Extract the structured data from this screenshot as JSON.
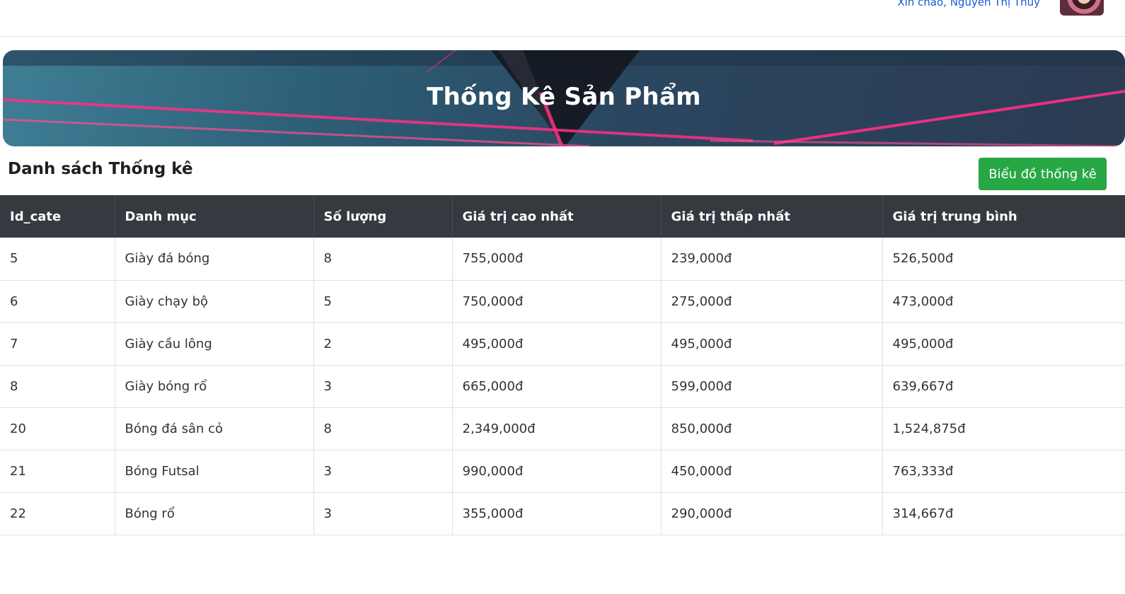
{
  "header": {
    "user_link": "Xin chào, Nguyễn Thị Thùy"
  },
  "banner": {
    "title": "Thống Kê Sản Phẩm"
  },
  "section": {
    "title": "Danh sách Thống kê",
    "chart_button": "Biểu đồ thống kê"
  },
  "colors": {
    "header_bg": "#343a40",
    "button_bg": "#28a745",
    "banner_accent": "#ff2f86"
  },
  "table": {
    "columns": [
      "Id_cate",
      "Danh mục",
      "Số lượng",
      "Giá trị cao nhất",
      "Giá trị thấp nhất",
      "Giá trị trung bình"
    ],
    "rows": [
      [
        "5",
        "Giày đá bóng",
        "8",
        "755,000đ",
        "239,000đ",
        "526,500đ"
      ],
      [
        "6",
        "Giày chạy bộ",
        "5",
        "750,000đ",
        "275,000đ",
        "473,000đ"
      ],
      [
        "7",
        "Giày cầu lông",
        "2",
        "495,000đ",
        "495,000đ",
        "495,000đ"
      ],
      [
        "8",
        "Giày bóng rổ",
        "3",
        "665,000đ",
        "599,000đ",
        "639,667đ"
      ],
      [
        "20",
        "Bóng đá sân cỏ",
        "8",
        "2,349,000đ",
        "850,000đ",
        "1,524,875đ"
      ],
      [
        "21",
        "Bóng Futsal",
        "3",
        "990,000đ",
        "450,000đ",
        "763,333đ"
      ],
      [
        "22",
        "Bóng rổ",
        "3",
        "355,000đ",
        "290,000đ",
        "314,667đ"
      ]
    ]
  }
}
